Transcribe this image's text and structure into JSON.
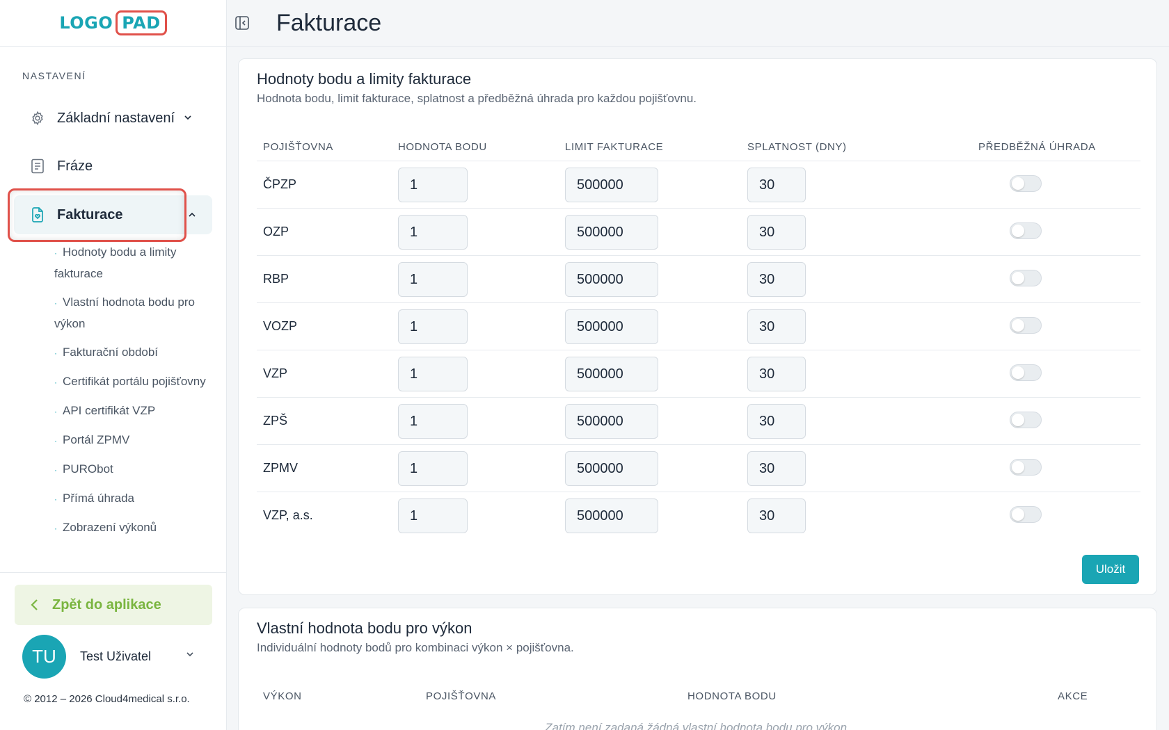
{
  "logo": {
    "part1": "LOGO",
    "part2": "PAD"
  },
  "sidebar": {
    "section_label": "NASTAVENÍ",
    "items": [
      {
        "label": "Základní nastavení",
        "icon": "gear-icon"
      },
      {
        "label": "Fráze",
        "icon": "document-icon"
      },
      {
        "label": "Fakturace",
        "icon": "invoice-icon"
      }
    ],
    "subitems": [
      "Hodnoty bodu a limity fakturace",
      "Vlastní hodnota bodu pro výkon",
      "Fakturační období",
      "Certifikát portálu pojišťovny",
      "API certifikát VZP",
      "Portál ZPMV",
      "PURObot",
      "Přímá úhrada",
      "Zobrazení výkonů"
    ],
    "back_label": "Zpět do aplikace",
    "user": {
      "initials": "TU",
      "name": "Test Uživatel"
    },
    "copyright": "© 2012 – 2026 Cloud4medical s.r.o."
  },
  "header": {
    "title": "Fakturace"
  },
  "card1": {
    "title": "Hodnoty bodu a limity fakturace",
    "subtitle": "Hodnota bodu, limit fakturace, splatnost a předběžná úhrada pro každou pojišťovnu.",
    "columns": [
      "POJIŠŤOVNA",
      "HODNOTA BODU",
      "LIMIT FAKTURACE",
      "SPLATNOST (DNY)",
      "PŘEDBĚŽNÁ ÚHRADA"
    ],
    "rows": [
      {
        "name": "ČPZP",
        "point": "1",
        "limit": "500000",
        "due": "30",
        "prepay": false
      },
      {
        "name": "OZP",
        "point": "1",
        "limit": "500000",
        "due": "30",
        "prepay": false
      },
      {
        "name": "RBP",
        "point": "1",
        "limit": "500000",
        "due": "30",
        "prepay": false
      },
      {
        "name": "VOZP",
        "point": "1",
        "limit": "500000",
        "due": "30",
        "prepay": false
      },
      {
        "name": "VZP",
        "point": "1",
        "limit": "500000",
        "due": "30",
        "prepay": false
      },
      {
        "name": "ZPŠ",
        "point": "1",
        "limit": "500000",
        "due": "30",
        "prepay": false
      },
      {
        "name": "ZPMV",
        "point": "1",
        "limit": "500000",
        "due": "30",
        "prepay": false
      },
      {
        "name": "VZP, a.s.",
        "point": "1",
        "limit": "500000",
        "due": "30",
        "prepay": false
      }
    ],
    "save_label": "Uložit"
  },
  "card2": {
    "title": "Vlastní hodnota bodu pro výkon",
    "subtitle": "Individuální hodnoty bodů pro kombinaci výkon × pojišťovna.",
    "columns": [
      "VÝKON",
      "POJIŠŤOVNA",
      "HODNOTA BODU",
      "AKCE"
    ],
    "empty": "Zatím není zadaná žádná vlastní hodnota bodu pro výkon."
  },
  "colors": {
    "accent": "#1aa5b4",
    "highlight": "#e0514a",
    "back_green": "#7ab540"
  }
}
